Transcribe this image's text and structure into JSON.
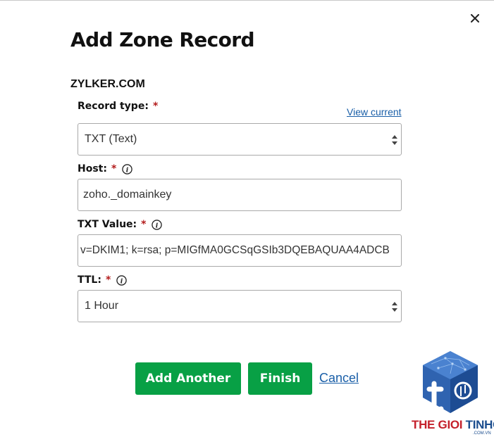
{
  "dialog": {
    "title": "Add Zone Record",
    "domain": "ZYLKER.COM"
  },
  "fields": {
    "record_type": {
      "label": "Record type:",
      "required_mark": "*",
      "value": "TXT (Text)",
      "link": "View current"
    },
    "host": {
      "label": "Host:",
      "required_mark": "*",
      "value": "zoho._domainkey"
    },
    "txt_value": {
      "label": "TXT Value:",
      "required_mark": "*",
      "value": "v=DKIM1; k=rsa; p=MIGfMA0GCSqGSIb3DQEBAQUAA4ADCB"
    },
    "ttl": {
      "label": "TTL:",
      "required_mark": "*",
      "value": "1 Hour"
    }
  },
  "actions": {
    "add_another": "Add Another",
    "finish": "Finish",
    "cancel": "Cancel"
  },
  "watermark": {
    "brand_part1": "THE GIOI",
    "brand_part2": "TINHOC",
    "sub": ".COM.VN"
  },
  "colors": {
    "primary_button": "#08a045",
    "link": "#1a5fa8",
    "required": "#b31b1b"
  },
  "icons": [
    "close-icon",
    "info-icon",
    "select-arrows-icon"
  ]
}
